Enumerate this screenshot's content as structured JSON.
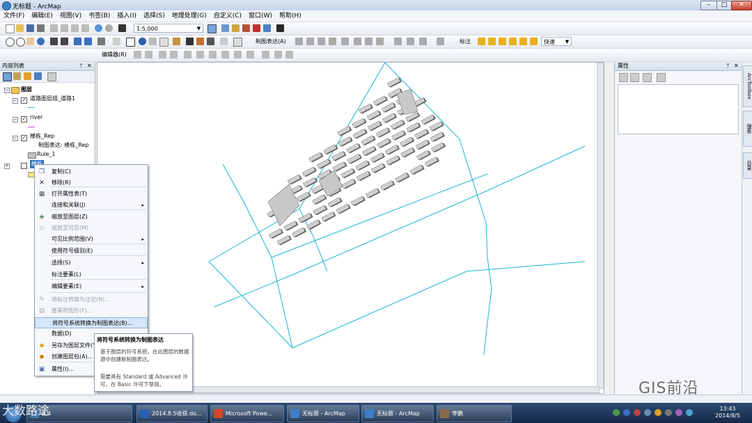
{
  "window": {
    "title": "无标题 - ArcMap",
    "minimize": "–",
    "maximize": "□",
    "close": "✕"
  },
  "menu": [
    "文件(F)",
    "编辑(E)",
    "视图(V)",
    "书签(B)",
    "插入(I)",
    "选择(S)",
    "地理处理(G)",
    "自定义(C)",
    "窗口(W)",
    "帮助(H)"
  ],
  "toolbar": {
    "scale": "1:5,000",
    "rep_label": "制图表达(A)",
    "label_label": "标注",
    "fast": "快速",
    "editor_label": "编辑器(R)"
  },
  "toc": {
    "title": "内容列表",
    "pin": "ᛘ",
    "close": "✕",
    "layers_root": "图层",
    "layers": [
      {
        "name": "道路图层组_道路1"
      },
      {
        "name": "river"
      },
      {
        "name": "楼栋_Rep"
      }
    ],
    "rep_line": "制图表达: 楼栋_Rep",
    "rule": "Rule_1",
    "selected_layer": "楼栋"
  },
  "context_menu": {
    "items": [
      {
        "label": "复制(C)",
        "icon": "copy-icon",
        "glyph": "❐",
        "color": "#4a6fa5"
      },
      {
        "label": "移除(R)",
        "icon": "remove-icon",
        "glyph": "✕",
        "color": "#222"
      },
      {
        "label": "打开属性表(T)",
        "icon": "table-icon",
        "glyph": "▦",
        "color": "#555"
      },
      {
        "label": "连接和关联(J)",
        "icon": "",
        "glyph": "",
        "sub": "▸"
      },
      {
        "label": "缩放至图层(Z)",
        "icon": "zoom-layer-icon",
        "glyph": "◈",
        "color": "#3a7a3a"
      },
      {
        "label": "缩放至可见(M)",
        "icon": "zoom-visible-icon",
        "glyph": "◇",
        "color": "#aaa",
        "disabled": true
      },
      {
        "label": "可见比例范围(V)",
        "icon": "",
        "glyph": "",
        "sub": "▸"
      },
      {
        "label": "使用符号级别(E)",
        "icon": "",
        "glyph": ""
      },
      {
        "label": "选择(S)",
        "icon": "",
        "glyph": "",
        "sub": "▸"
      },
      {
        "label": "标注要素(L)",
        "icon": "",
        "glyph": ""
      },
      {
        "label": "编辑要素(E)",
        "icon": "",
        "glyph": "",
        "sub": "▸"
      },
      {
        "label": "将标注转换为注记(N)...",
        "icon": "annotation-icon",
        "glyph": "✎",
        "color": "#aaa",
        "disabled": true
      },
      {
        "label": "要素转图形(F)...",
        "icon": "feature-graphic-icon",
        "glyph": "▤",
        "color": "#aaa",
        "disabled": true
      },
      {
        "label": "将符号系统转换为制图表达(B)...",
        "icon": "",
        "glyph": "",
        "highlight": true
      },
      {
        "label": "数据(D)",
        "icon": "",
        "glyph": ""
      },
      {
        "label": "另存为图层文件(Y)...",
        "icon": "layer-file-icon",
        "glyph": "◆",
        "color": "#e0a020"
      },
      {
        "label": "创建图层包(A)...",
        "icon": "layer-package-icon",
        "glyph": "◆",
        "color": "#d07a10"
      },
      {
        "label": "属性(I)...",
        "icon": "properties-icon",
        "glyph": "▣",
        "color": "#4a6fa5"
      }
    ]
  },
  "tooltip": {
    "title": "将符号系统转换为制图表达",
    "body": "基于图层的符号系统，在此图层的数据源中创建新制图表达。",
    "note": "需要具有 Standard 或 Advanced 许可，在 Basic 许可下禁用。"
  },
  "properties": {
    "title": "属性",
    "pin": "ᛘ",
    "close": "✕"
  },
  "dock_tabs": [
    "ArcToolbox",
    "搜索",
    "目录"
  ],
  "watermark": "GIS前沿",
  "watermark_left": "大数路途",
  "taskbar": {
    "tasks": [
      {
        "label": "A 4",
        "icon_color": "#4477aa"
      },
      {
        "label": "2014.8.5收获.do...",
        "icon_color": "#2b5fb3"
      },
      {
        "label": "Microsoft Powe...",
        "icon_color": "#d24726"
      },
      {
        "label": "无标题 - ArcMap",
        "icon_color": "#3c7fc7"
      },
      {
        "label": "无标题 - ArcMap",
        "icon_color": "#3c7fc7"
      },
      {
        "label": "李鹏",
        "icon_color": "#8a6a4a"
      }
    ],
    "time": "13:43",
    "date": "2014/8/5"
  },
  "colors": {
    "road": "#19b4d2",
    "building": "#cfcfcf",
    "building_edge": "#7a7a7a"
  }
}
